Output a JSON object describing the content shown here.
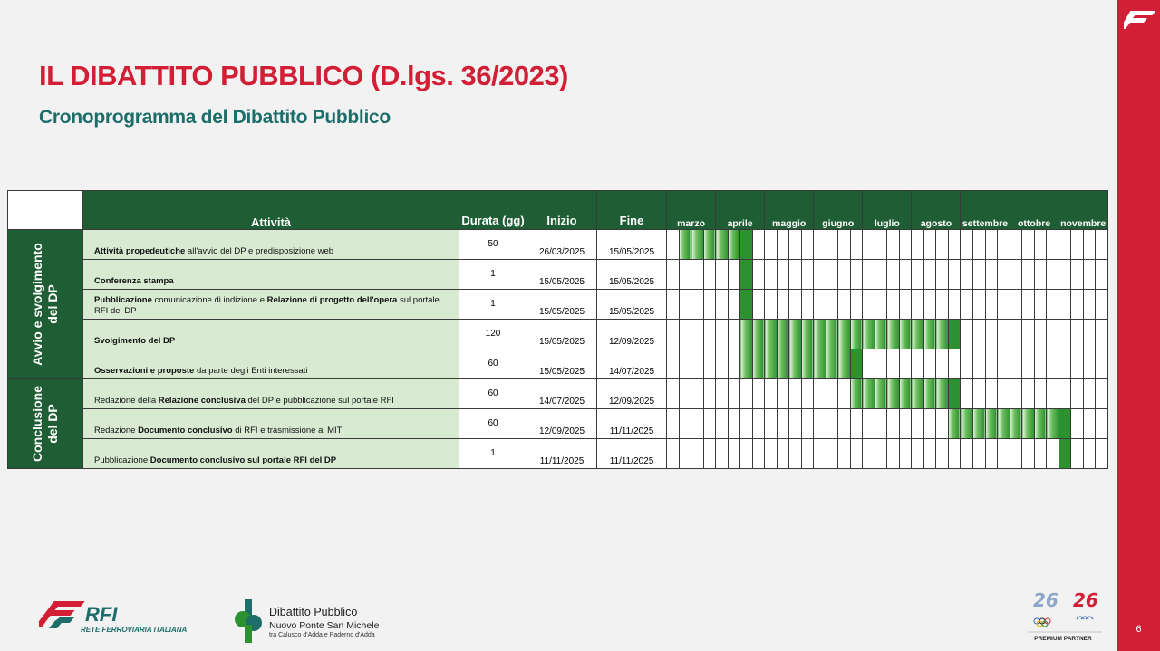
{
  "header": {
    "title": "IL DIBATTITO PUBBLICO (D.lgs. 36/2023)",
    "subtitle": "Cronoprogramma del Dibattito Pubblico"
  },
  "table": {
    "col_activity": "Attività",
    "col_duration": "Durata (gg)",
    "col_start": "Inizio",
    "col_end": "Fine",
    "months": [
      "marzo",
      "aprile",
      "maggio",
      "giugno",
      "luglio",
      "agosto",
      "settembre",
      "ottobre",
      "novembre"
    ],
    "groups": [
      {
        "label": "Avvio e svolgimento del DP",
        "rows": 5
      },
      {
        "label": "Conclusione del DP",
        "rows": 3
      }
    ],
    "rows": [
      {
        "activity": [
          {
            "t": "Attività propedeutiche",
            "b": true
          },
          {
            "t": " all'avvio del DP e predisposizione web",
            "b": false
          }
        ],
        "duration": "50",
        "start": "26/03/2025",
        "end": "15/05/2025",
        "bar": [
          1,
          6
        ],
        "solid": [
          6
        ]
      },
      {
        "activity": [
          {
            "t": "Conferenza stampa",
            "b": true
          }
        ],
        "duration": "1",
        "start": "15/05/2025",
        "end": "15/05/2025",
        "bar": [
          6,
          6
        ],
        "solid": [
          6
        ]
      },
      {
        "activity": [
          {
            "t": "Pubblicazione",
            "b": true
          },
          {
            "t": " comunicazione di indizione e ",
            "b": false
          },
          {
            "t": "Relazione di progetto dell'opera",
            "b": true
          },
          {
            "t": " sul portale RFI del DP",
            "b": false
          }
        ],
        "duration": "1",
        "start": "15/05/2025",
        "end": "15/05/2025",
        "bar": [
          6,
          6
        ],
        "solid": [
          6
        ]
      },
      {
        "activity": [
          {
            "t": "Svolgimento del DP",
            "b": true
          }
        ],
        "duration": "120",
        "start": "15/05/2025",
        "end": "12/09/2025",
        "bar": [
          6,
          23
        ],
        "solid": [
          23
        ]
      },
      {
        "activity": [
          {
            "t": "Osservazioni e proposte",
            "b": true
          },
          {
            "t": " da parte degli Enti interessati",
            "b": false
          }
        ],
        "duration": "60",
        "start": "15/05/2025",
        "end": "14/07/2025",
        "bar": [
          6,
          15
        ],
        "solid": [
          15
        ]
      },
      {
        "activity": [
          {
            "t": "Redazione della ",
            "b": false
          },
          {
            "t": "Relazione conclusiva",
            "b": true
          },
          {
            "t": " del DP  e pubblicazione sul portale RFI",
            "b": false
          }
        ],
        "duration": "60",
        "start": "14/07/2025",
        "end": "12/09/2025",
        "bar": [
          15,
          23
        ],
        "solid": [
          23
        ]
      },
      {
        "activity": [
          {
            "t": "Redazione ",
            "b": false
          },
          {
            "t": "Documento conclusivo",
            "b": true
          },
          {
            "t": " di RFI  e trasmissione al MIT",
            "b": false
          }
        ],
        "duration": "60",
        "start": "12/09/2025",
        "end": "11/11/2025",
        "bar": [
          23,
          32
        ],
        "solid": [
          32
        ]
      },
      {
        "activity": [
          {
            "t": "Pubblicazione ",
            "b": false
          },
          {
            "t": "Documento conclusivo sul portale RFI del DP",
            "b": true
          }
        ],
        "duration": "1",
        "start": "11/11/2025",
        "end": "11/11/2025",
        "bar": [
          32,
          32
        ],
        "solid": [
          32
        ]
      }
    ]
  },
  "footer": {
    "rfi_brand": "RFI",
    "rfi_name": "RETE FERROVIARIA ITALIANA",
    "dp_title": "Dibattito Pubblico",
    "dp_project": "Nuovo Ponte San Michele",
    "dp_location": "tra Calusco d'Adda e Paderno d'Adda",
    "partner_label": "PREMIUM PARTNER",
    "page_number": "6"
  },
  "colors": {
    "brand_red": "#d21f35",
    "table_green": "#1f5e34",
    "bar_green": "#2e9130",
    "activity_bg": "#d8ebd2",
    "subtitle_teal": "#1d6e6a"
  }
}
